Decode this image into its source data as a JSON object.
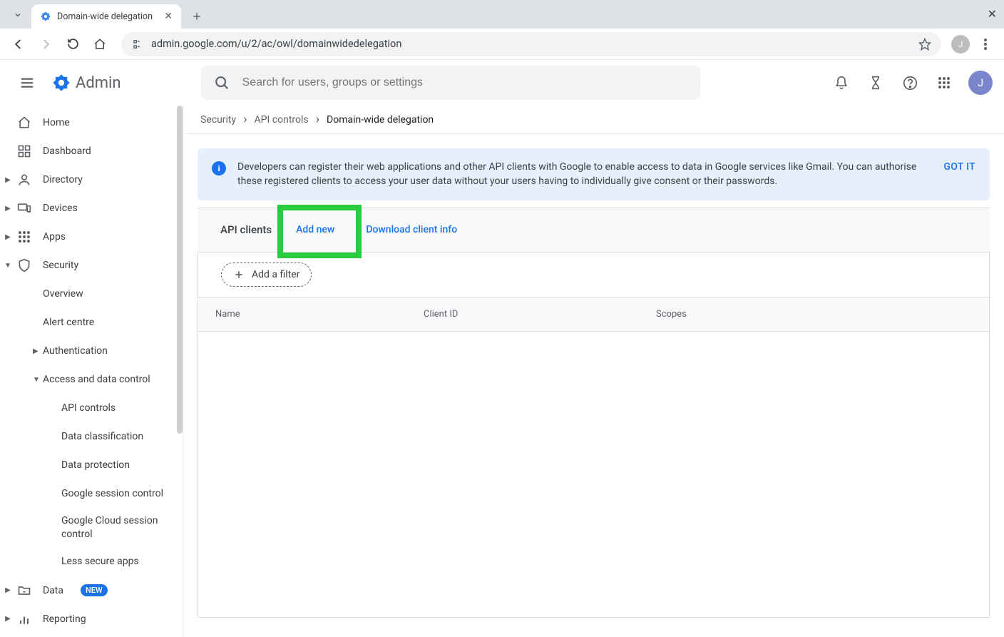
{
  "browser": {
    "tab_title": "Domain-wide delegation",
    "url": "admin.google.com/u/2/ac/owl/domainwidedelegation",
    "profile_initial": "J"
  },
  "header": {
    "product_name": "Admin",
    "search_placeholder": "Search for users, groups or settings",
    "avatar_initial": "J"
  },
  "sidebar": {
    "home": "Home",
    "dashboard": "Dashboard",
    "directory": "Directory",
    "devices": "Devices",
    "apps": "Apps",
    "security": "Security",
    "security_children": {
      "overview": "Overview",
      "alert_centre": "Alert centre",
      "authentication": "Authentication",
      "access_data": "Access and data control",
      "access_children": {
        "api_controls": "API controls",
        "data_classification": "Data classification",
        "data_protection": "Data protection",
        "session_control": "Google session control",
        "cloud_session": "Google Cloud session control",
        "less_secure": "Less secure apps"
      }
    },
    "data": "Data",
    "data_badge": "NEW",
    "reporting": "Reporting"
  },
  "breadcrumb": {
    "security": "Security",
    "api_controls": "API controls",
    "current": "Domain-wide delegation"
  },
  "banner": {
    "message": "Developers can register their web applications and other API clients with Google to enable access to data in Google services like Gmail. You can authorise these registered clients to access your user data without your users having to individually give consent or their passwords.",
    "action": "GOT IT"
  },
  "panel": {
    "title": "API clients",
    "add_new": "Add new",
    "download": "Download client info",
    "add_filter": "Add a filter"
  },
  "table": {
    "col_name": "Name",
    "col_client_id": "Client ID",
    "col_scopes": "Scopes",
    "rows": []
  }
}
